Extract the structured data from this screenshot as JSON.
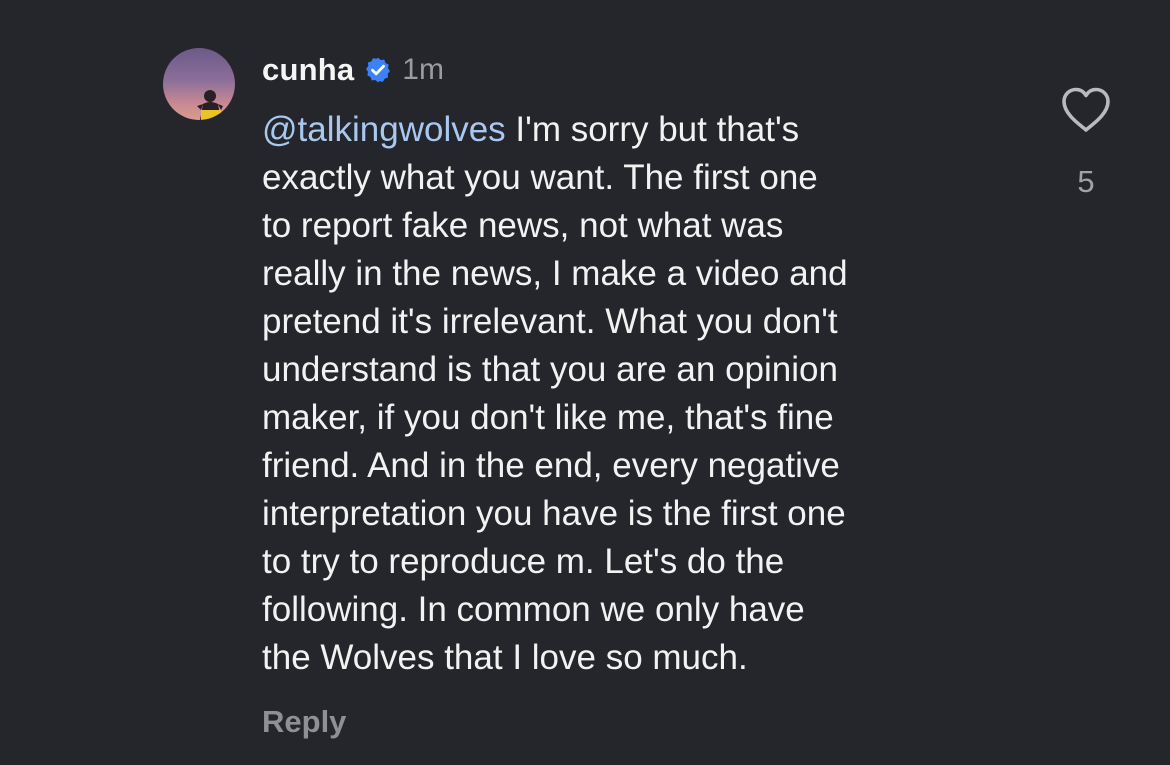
{
  "comment": {
    "username": "cunha",
    "timestamp": "1m",
    "mention": "@talkingwolves",
    "lines": [
      " I'm sorry but that's",
      "exactly what you want. The first one",
      "to report fake news, not what was",
      "really in the news, I make a video and",
      "pretend it's irrelevant. What you don't",
      "understand is that you are an opinion",
      "maker, if you don't like me, that's fine",
      "friend. And in the end, every negative",
      "interpretation you have is the first one",
      "to try to reproduce m. Let's do the",
      "following. In common we only have",
      "the Wolves that I love so much."
    ],
    "reply_label": "Reply",
    "like_count": "5"
  },
  "icons": {
    "verified": "verified-badge-icon",
    "like": "heart-outline-icon"
  },
  "colors": {
    "background": "#24262b",
    "mention": "#a8c8f0",
    "verified": "#3b82f6",
    "muted": "#8e9096"
  }
}
